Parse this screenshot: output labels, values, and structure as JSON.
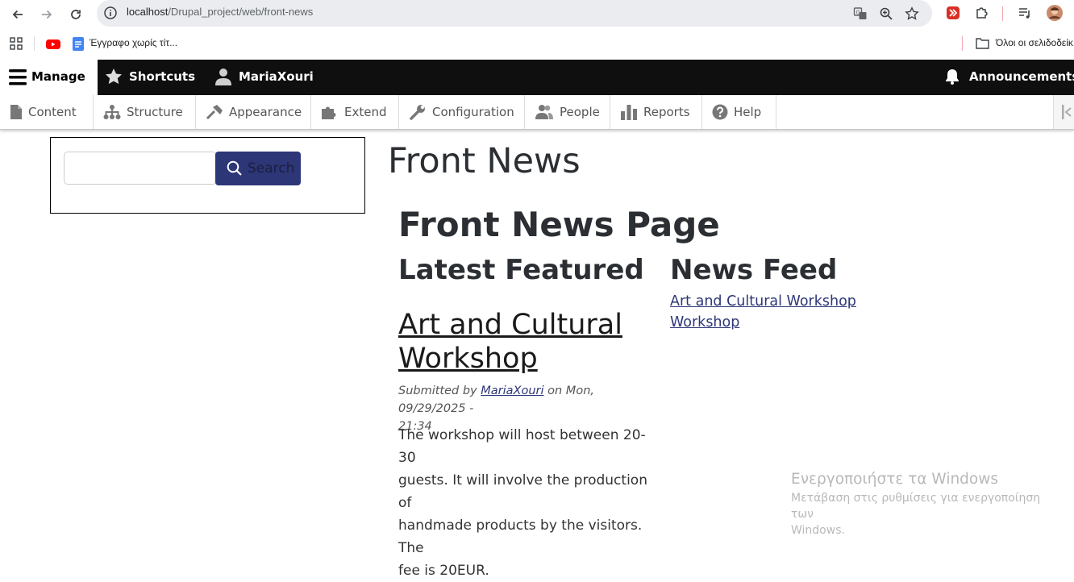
{
  "browser": {
    "url_host": "localhost",
    "url_path": "/Drupal_project/web/front-news"
  },
  "bookmarks": {
    "doc_label": "Έγγραφο χωρίς τίτ...",
    "all_bookmarks_label": "Όλοι οι σελιδοδείκ"
  },
  "toolbar": {
    "manage_label": "Manage",
    "shortcuts_label": "Shortcuts",
    "user_label": "MariaXouri",
    "announcements_label": "Announcements"
  },
  "tray": {
    "items": [
      {
        "label": "Content",
        "icon": "content-icon"
      },
      {
        "label": "Structure",
        "icon": "structure-icon"
      },
      {
        "label": "Appearance",
        "icon": "appearance-icon"
      },
      {
        "label": "Extend",
        "icon": "extend-icon"
      },
      {
        "label": "Configuration",
        "icon": "configuration-icon"
      },
      {
        "label": "People",
        "icon": "people-icon"
      },
      {
        "label": "Reports",
        "icon": "reports-icon"
      },
      {
        "label": "Help",
        "icon": "help-icon"
      }
    ]
  },
  "search": {
    "value": "",
    "button_label": "Search"
  },
  "page": {
    "title": "Front News",
    "front_page_title": "Front News Page",
    "latest_featured_title": "Latest Featured",
    "news_feed_title": "News Feed"
  },
  "article": {
    "title_line1": "Art and Cultural",
    "title_line2": "Workshop",
    "submitted_prefix": "Submitted by",
    "author": "MariaXouri",
    "date_line1": "on Mon, 09/29/2025 -",
    "date_line2": "21:34",
    "body_lines": [
      "The workshop will host between 20-30",
      "guests. It will involve the production of",
      "handmade products by the visitors. The",
      "fee is 20EUR."
    ]
  },
  "news_feed": {
    "link1": "Art and Cultural Workshop",
    "link2": "Workshop"
  },
  "windows": {
    "line1": "Ενεργοποιήστε τα Windows",
    "line2": "Μετάβαση στις ρυθμίσεις για ενεργοποίηση των",
    "line3": "Windows."
  },
  "colors": {
    "accent": "#2d3677",
    "toolbar_dark": "#0f0f0f"
  }
}
